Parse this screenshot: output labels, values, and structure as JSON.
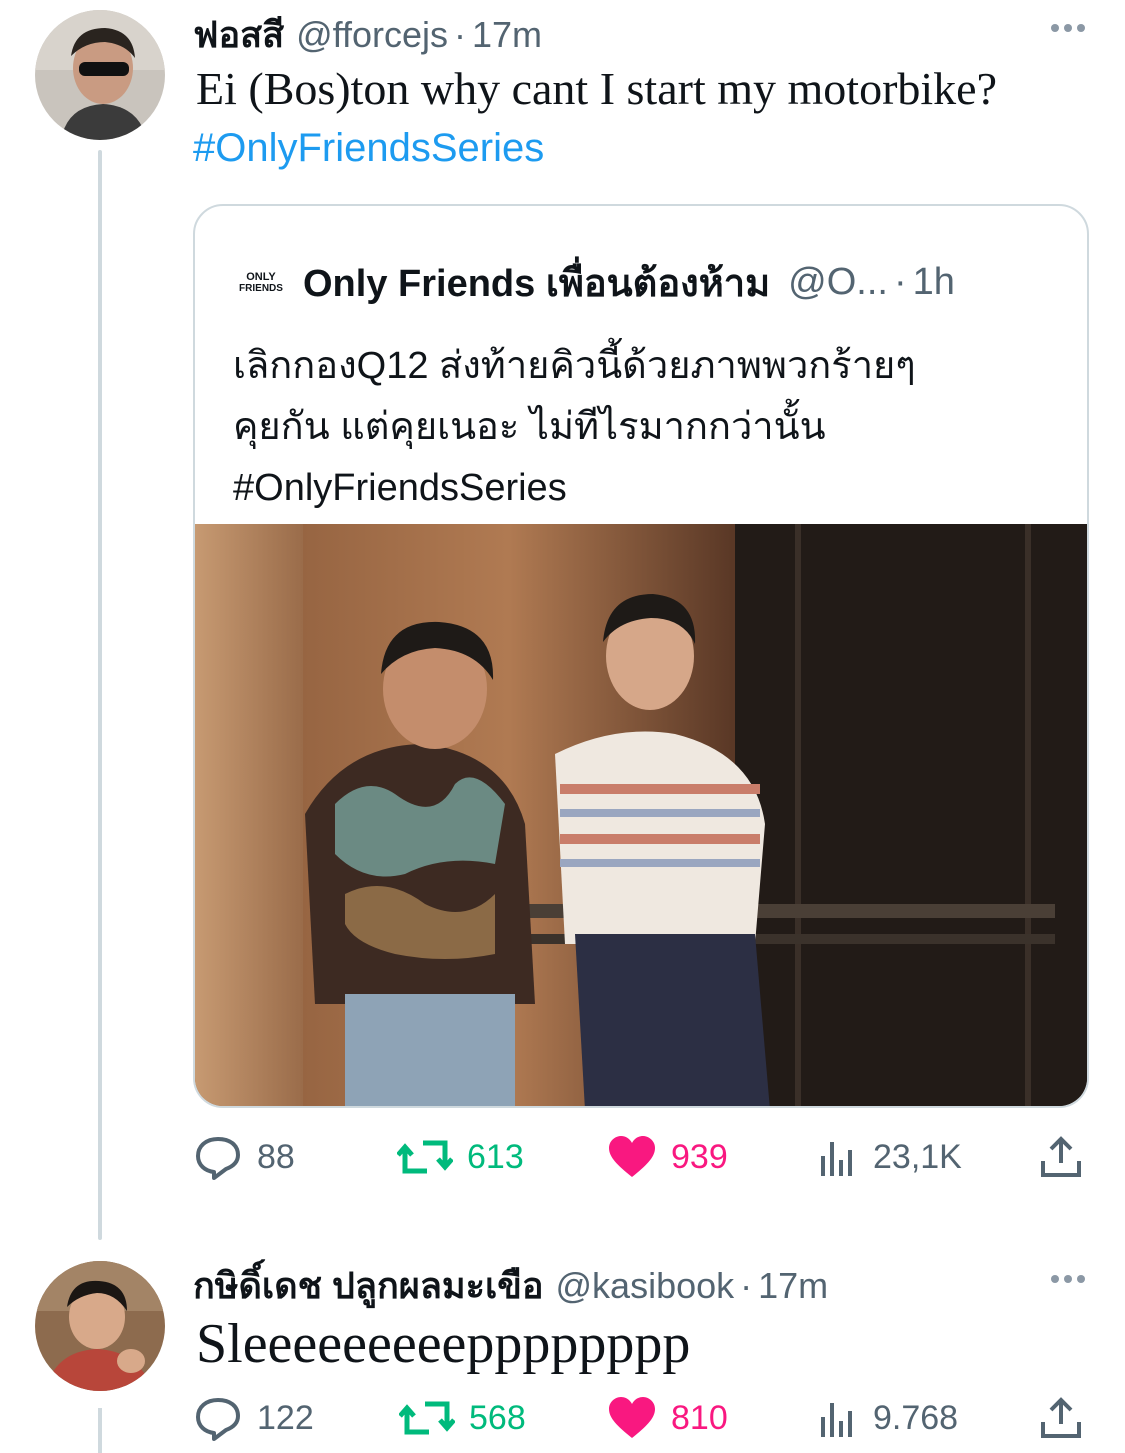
{
  "tweet1": {
    "name": "ฟอสสี",
    "handle": "@fforcejs",
    "separator": "·",
    "time": "17m",
    "text": "Ei (Bos)ton why cant I start my motorbike?",
    "hashtag": "#OnlyFriendsSeries",
    "quote": {
      "logo_line1": "ONLY",
      "logo_line2": "FRIENDS",
      "name": "Only Friends เพื่อนต้องห้าม",
      "handle": "@O...",
      "separator": "·",
      "time": "1h",
      "lines": [
        "เลิกกองQ12 ส่งท้ายคิวนี้ด้วยภาพพวกร้ายๆ",
        "คุยกัน แต่คุยเนอะ ไม่ทีไรมากกว่านั้น",
        "#OnlyFriendsSeries"
      ]
    },
    "stats": {
      "replies": "88",
      "retweets": "613",
      "likes": "939",
      "views": "23,1K"
    }
  },
  "tweet2": {
    "name": "กษิดิ์เดช ปลูกผลมะเขือ",
    "handle": "@kasibook",
    "separator": "·",
    "time": "17m",
    "text": "Sleeeeeeeeepppppppp",
    "stats": {
      "replies": "122",
      "retweets": "568",
      "likes": "810",
      "views": "9.768"
    }
  },
  "colors": {
    "link": "#1d9bf0",
    "retweet": "#00ba7c",
    "like": "#f91880",
    "muted": "#536471"
  }
}
